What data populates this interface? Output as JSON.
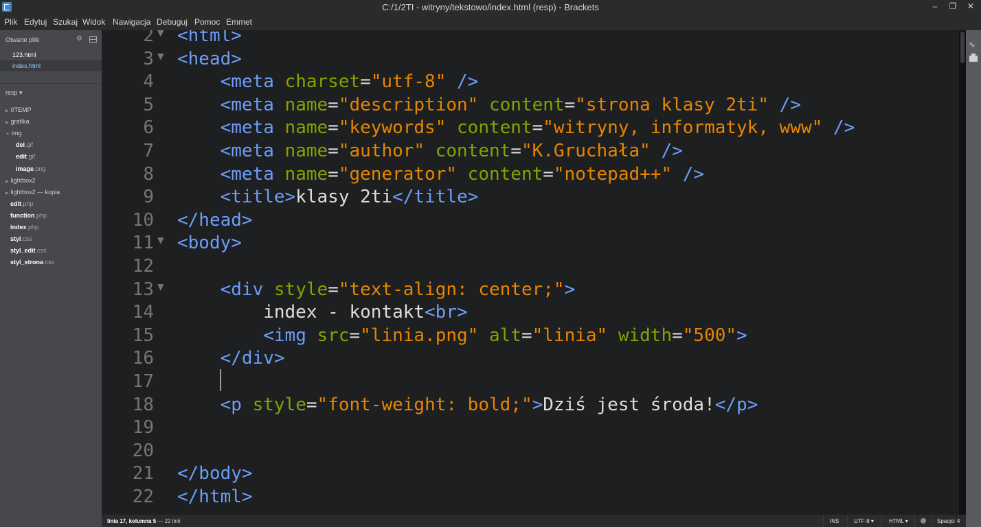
{
  "window": {
    "title": "C:/1/2TI - witryny/tekstowo/index.html (resp) - Brackets"
  },
  "menu": [
    "Plik",
    "Edytuj",
    "Szukaj",
    "Widok",
    "Nawigacja",
    "Debuguj",
    "Pomoc",
    "Emmet"
  ],
  "sidebar": {
    "working_files_label": "Otwarte pliki",
    "working_files": [
      "123.html",
      "index.html"
    ],
    "active_file": "index.html",
    "project_label": "resp ▾",
    "tree": [
      {
        "type": "folder",
        "name": "0TEMP",
        "expanded": false
      },
      {
        "type": "folder",
        "name": "grafika",
        "expanded": false
      },
      {
        "type": "folder",
        "name": "img",
        "expanded": true
      },
      {
        "type": "file",
        "name": "del",
        "ext": ".gif",
        "indent": 1
      },
      {
        "type": "file",
        "name": "edit",
        "ext": ".gif",
        "indent": 1
      },
      {
        "type": "file",
        "name": "image",
        "ext": ".png",
        "indent": 1
      },
      {
        "type": "folder",
        "name": "lightbox2",
        "expanded": false
      },
      {
        "type": "folder",
        "name": "lightbox2 — kopia",
        "expanded": false
      },
      {
        "type": "file",
        "name": "edit",
        "ext": ".php",
        "indent": 0
      },
      {
        "type": "file",
        "name": "function",
        "ext": ".php",
        "indent": 0
      },
      {
        "type": "file",
        "name": "index",
        "ext": ".php",
        "indent": 0
      },
      {
        "type": "file",
        "name": "styl",
        "ext": ".css",
        "indent": 0
      },
      {
        "type": "file",
        "name": "styl_edit",
        "ext": ".css",
        "indent": 0
      },
      {
        "type": "file",
        "name": "styl_strona",
        "ext": ".css",
        "indent": 0
      }
    ]
  },
  "editor": {
    "lines": [
      {
        "n": "2",
        "fold": true,
        "tokens": [
          [
            "tag",
            "<html>"
          ]
        ]
      },
      {
        "n": "3",
        "fold": true,
        "tokens": [
          [
            "tag",
            "<head>"
          ]
        ]
      },
      {
        "n": "4",
        "tokens": [
          [
            "txt",
            "    "
          ],
          [
            "tag",
            "<meta "
          ],
          [
            "attr",
            "charset"
          ],
          [
            "txt",
            "="
          ],
          [
            "str",
            "\"utf-8\""
          ],
          [
            "tag",
            " />"
          ]
        ]
      },
      {
        "n": "5",
        "tokens": [
          [
            "txt",
            "    "
          ],
          [
            "tag",
            "<meta "
          ],
          [
            "attr",
            "name"
          ],
          [
            "txt",
            "="
          ],
          [
            "str",
            "\"description\""
          ],
          [
            "txt",
            " "
          ],
          [
            "attr",
            "content"
          ],
          [
            "txt",
            "="
          ],
          [
            "str",
            "\"strona klasy 2ti\""
          ],
          [
            "tag",
            " />"
          ]
        ]
      },
      {
        "n": "6",
        "tokens": [
          [
            "txt",
            "    "
          ],
          [
            "tag",
            "<meta "
          ],
          [
            "attr",
            "name"
          ],
          [
            "txt",
            "="
          ],
          [
            "str",
            "\"keywords\""
          ],
          [
            "txt",
            " "
          ],
          [
            "attr",
            "content"
          ],
          [
            "txt",
            "="
          ],
          [
            "str",
            "\"witryny, informatyk, www\""
          ],
          [
            "tag",
            " />"
          ]
        ]
      },
      {
        "n": "7",
        "tokens": [
          [
            "txt",
            "    "
          ],
          [
            "tag",
            "<meta "
          ],
          [
            "attr",
            "name"
          ],
          [
            "txt",
            "="
          ],
          [
            "str",
            "\"author\""
          ],
          [
            "txt",
            " "
          ],
          [
            "attr",
            "content"
          ],
          [
            "txt",
            "="
          ],
          [
            "str",
            "\"K.Gruchała\""
          ],
          [
            "tag",
            " />"
          ]
        ]
      },
      {
        "n": "8",
        "tokens": [
          [
            "txt",
            "    "
          ],
          [
            "tag",
            "<meta "
          ],
          [
            "attr",
            "name"
          ],
          [
            "txt",
            "="
          ],
          [
            "str",
            "\"generator\""
          ],
          [
            "txt",
            " "
          ],
          [
            "attr",
            "content"
          ],
          [
            "txt",
            "="
          ],
          [
            "str",
            "\"notepad++\""
          ],
          [
            "tag",
            " />"
          ]
        ]
      },
      {
        "n": "9",
        "tokens": [
          [
            "txt",
            "    "
          ],
          [
            "tag",
            "<title>"
          ],
          [
            "txt",
            "klasy 2ti"
          ],
          [
            "tag",
            "</title>"
          ]
        ]
      },
      {
        "n": "10",
        "tokens": [
          [
            "tag",
            "</head>"
          ]
        ]
      },
      {
        "n": "11",
        "fold": true,
        "tokens": [
          [
            "tag",
            "<body>"
          ]
        ]
      },
      {
        "n": "12",
        "tokens": []
      },
      {
        "n": "13",
        "fold": true,
        "tokens": [
          [
            "txt",
            "    "
          ],
          [
            "tag",
            "<div "
          ],
          [
            "attr",
            "style"
          ],
          [
            "txt",
            "="
          ],
          [
            "str",
            "\"text-align: center;\""
          ],
          [
            "tag",
            ">"
          ]
        ]
      },
      {
        "n": "14",
        "tokens": [
          [
            "txt",
            "        index - kontakt"
          ],
          [
            "tag",
            "<br>"
          ]
        ]
      },
      {
        "n": "15",
        "tokens": [
          [
            "txt",
            "        "
          ],
          [
            "tag",
            "<img "
          ],
          [
            "attr",
            "src"
          ],
          [
            "txt",
            "="
          ],
          [
            "str",
            "\"linia.png\""
          ],
          [
            "txt",
            " "
          ],
          [
            "attr",
            "alt"
          ],
          [
            "txt",
            "="
          ],
          [
            "str",
            "\"linia\""
          ],
          [
            "txt",
            " "
          ],
          [
            "attr",
            "width"
          ],
          [
            "txt",
            "="
          ],
          [
            "str",
            "\"500\""
          ],
          [
            "tag",
            ">"
          ]
        ]
      },
      {
        "n": "16",
        "tokens": [
          [
            "txt",
            "    "
          ],
          [
            "tag",
            "</div>"
          ]
        ]
      },
      {
        "n": "17",
        "tokens": []
      },
      {
        "n": "18",
        "tokens": [
          [
            "txt",
            "    "
          ],
          [
            "tag",
            "<p "
          ],
          [
            "attr",
            "style"
          ],
          [
            "txt",
            "="
          ],
          [
            "str",
            "\"font-weight: bold;\""
          ],
          [
            "tag",
            ">"
          ],
          [
            "txt",
            "Dziś jest środa!"
          ],
          [
            "tag",
            "</p>"
          ]
        ]
      },
      {
        "n": "19",
        "tokens": []
      },
      {
        "n": "20",
        "tokens": []
      },
      {
        "n": "21",
        "tokens": [
          [
            "tag",
            "</body>"
          ]
        ]
      },
      {
        "n": "22",
        "tokens": [
          [
            "tag",
            "</html>"
          ]
        ]
      }
    ]
  },
  "statusbar": {
    "position_bold": "linia 17, kolumna 5",
    "position_rest": " — 22 linii",
    "ins": "INS",
    "encoding": "UTF-8 ▾",
    "language": "HTML ▾",
    "spaces": "Spacje: 4"
  },
  "colors": {
    "tag": "#6c9ef8",
    "attr": "#85a300",
    "string": "#e88501",
    "text": "#dedede",
    "editor_bg": "#1d1f21",
    "sidebar_bg": "#47484b"
  },
  "icons": [
    "app-icon",
    "minimize-icon",
    "maximize-icon",
    "close-icon",
    "gear-icon",
    "split-view-icon",
    "live-preview-icon",
    "extension-manager-icon",
    "linter-status-icon"
  ]
}
